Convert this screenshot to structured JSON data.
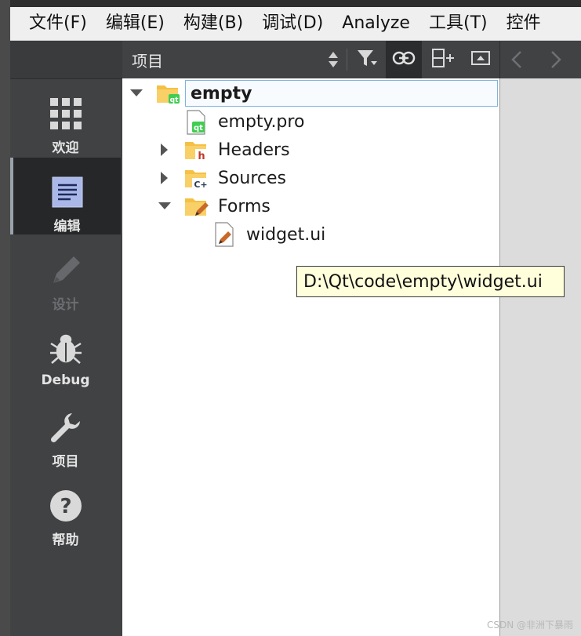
{
  "menubar": {
    "items": [
      "文件(F)",
      "编辑(E)",
      "构建(B)",
      "调试(D)",
      "Analyze",
      "工具(T)",
      "控件"
    ]
  },
  "modes": [
    {
      "label": "欢迎",
      "icon": "grid-icon",
      "state": "normal"
    },
    {
      "label": "编辑",
      "icon": "document-icon",
      "state": "active"
    },
    {
      "label": "设计",
      "icon": "pencil-icon",
      "state": "disabled"
    },
    {
      "label": "Debug",
      "icon": "bug-icon",
      "state": "normal"
    },
    {
      "label": "项目",
      "icon": "wrench-icon",
      "state": "normal"
    },
    {
      "label": "帮助",
      "icon": "help-icon",
      "state": "normal"
    }
  ],
  "project_panel": {
    "title": "项目",
    "toolbar": [
      "filter-icon",
      "link-icon",
      "split-add-icon",
      "maximize-icon"
    ],
    "nav": [
      "back-icon",
      "forward-icon"
    ]
  },
  "tree": [
    {
      "label": "empty",
      "level": 0,
      "expanded": true,
      "icon": "qt-project-folder-icon",
      "bold": true,
      "selected": true
    },
    {
      "label": "empty.pro",
      "level": 1,
      "icon": "qt-pro-file-icon"
    },
    {
      "label": "Headers",
      "level": 1,
      "expanded": false,
      "icon": "headers-folder-icon"
    },
    {
      "label": "Sources",
      "level": 1,
      "expanded": false,
      "icon": "sources-folder-icon"
    },
    {
      "label": "Forms",
      "level": 1,
      "expanded": true,
      "icon": "forms-folder-icon"
    },
    {
      "label": "widget.ui",
      "level": 2,
      "icon": "ui-file-icon"
    }
  ],
  "tooltip": "D:\\Qt\\code\\empty\\widget.ui",
  "watermark": "CSDN @非洲下暴雨",
  "colors": {
    "sidebar_bg": "#404244",
    "active_mode_bg": "#262728",
    "tooltip_bg": "#ffffdc",
    "selection_border": "#7fb4de",
    "folder_yellow": "#f5c043"
  }
}
